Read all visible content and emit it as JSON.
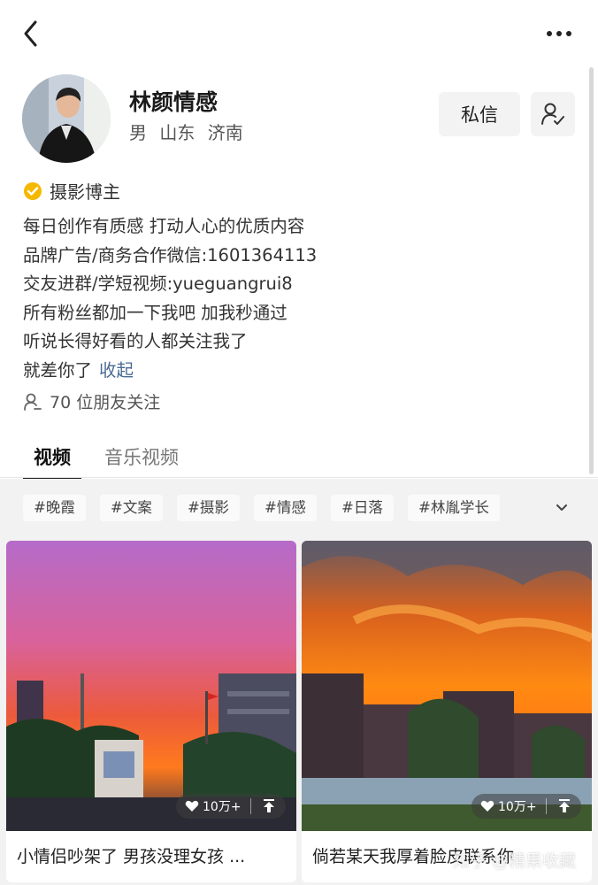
{
  "profile": {
    "name": "林颜情感",
    "gender": "男",
    "location": "山东 济南",
    "message_label": "私信",
    "verified_label": "摄影博主",
    "bio": [
      "每日创作有质感 打动人心的优质内容",
      "品牌广告/商务合作微信:1601364113",
      "交友进群/学短视频:yueguangrui8",
      "所有粉丝都加一下我吧 加我秒通过",
      "听说长得好看的人都关注我了",
      "就差你了"
    ],
    "collapse_label": "收起",
    "friends_text": "70 位朋友关注"
  },
  "tabs": [
    {
      "label": "视频",
      "active": true
    },
    {
      "label": "音乐视频",
      "active": false
    }
  ],
  "tags": [
    "#晚霞",
    "#文案",
    "#摄影",
    "#情感",
    "#日落",
    "#林胤学长"
  ],
  "videos": [
    {
      "title": "小情侣吵架了 男孩没理女孩 ...",
      "likes": "10万+"
    },
    {
      "title": "倘若某天我厚着脸皮联系你",
      "likes": "10万+"
    }
  ],
  "watermark": "知乎 @精果收藏",
  "icons": {
    "back": "chevron-left-icon",
    "more": "more-dots-icon",
    "follow": "add-friend-icon",
    "verified": "verified-badge-icon",
    "friends": "person-icon",
    "expand": "chevron-down-icon",
    "like": "heart-icon",
    "share": "upload-icon"
  },
  "colors": {
    "verified_badge": "#f5b800",
    "link": "#4a6a93"
  }
}
